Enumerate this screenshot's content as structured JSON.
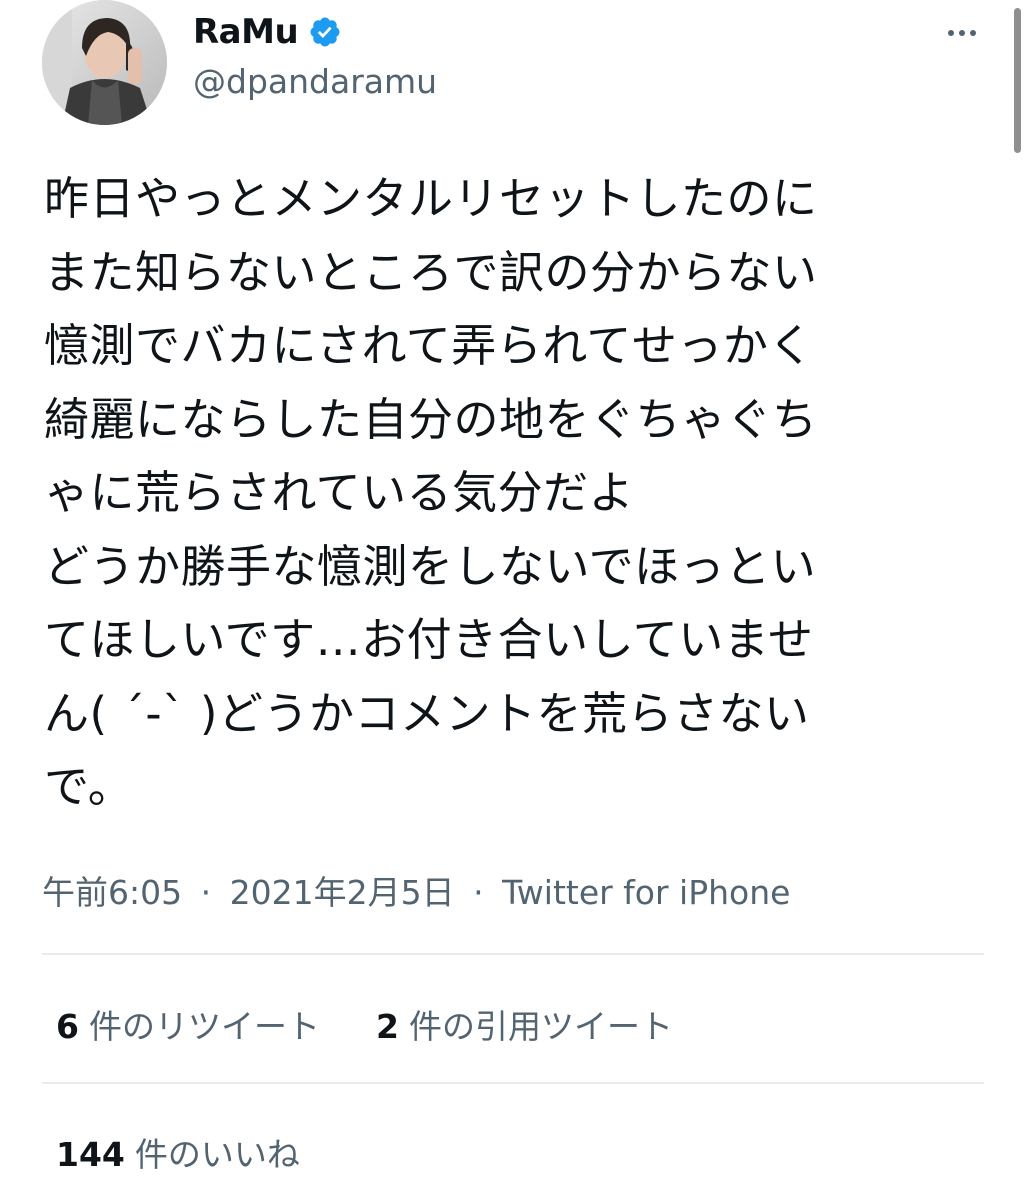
{
  "author": {
    "display_name": "RaMu",
    "handle": "@dpandaramu",
    "verified": true,
    "avatar_icon": "user-photo",
    "more_icon": "more-horizontal-icon"
  },
  "tweet": {
    "lines": [
      "昨日やっとメンタルリセットしたのに",
      "また知らないところで訳の分からない",
      "憶測でバカにされて弄られてせっかく",
      "綺麗にならした自分の地をぐちゃぐち",
      "ゃに荒らされている気分だよ",
      "どうか勝手な憶測をしないでほっとい",
      "てほしいです…お付き合いしていませ",
      "ん( ´-` )どうかコメントを荒らさない",
      "で。"
    ]
  },
  "meta": {
    "time": "午前6:05",
    "separator": "·",
    "date": "2021年2月5日",
    "source": "Twitter for iPhone"
  },
  "stats": {
    "retweets": {
      "count": "6",
      "label": "件のリツイート"
    },
    "quotes": {
      "count": "2",
      "label": "件の引用ツイート"
    },
    "likes": {
      "count": "144",
      "label": "件のいいね"
    }
  },
  "colors": {
    "text": "#0f1419",
    "secondary": "#536471",
    "verified": "#1d9bf0",
    "divider": "#e6ecf0"
  }
}
